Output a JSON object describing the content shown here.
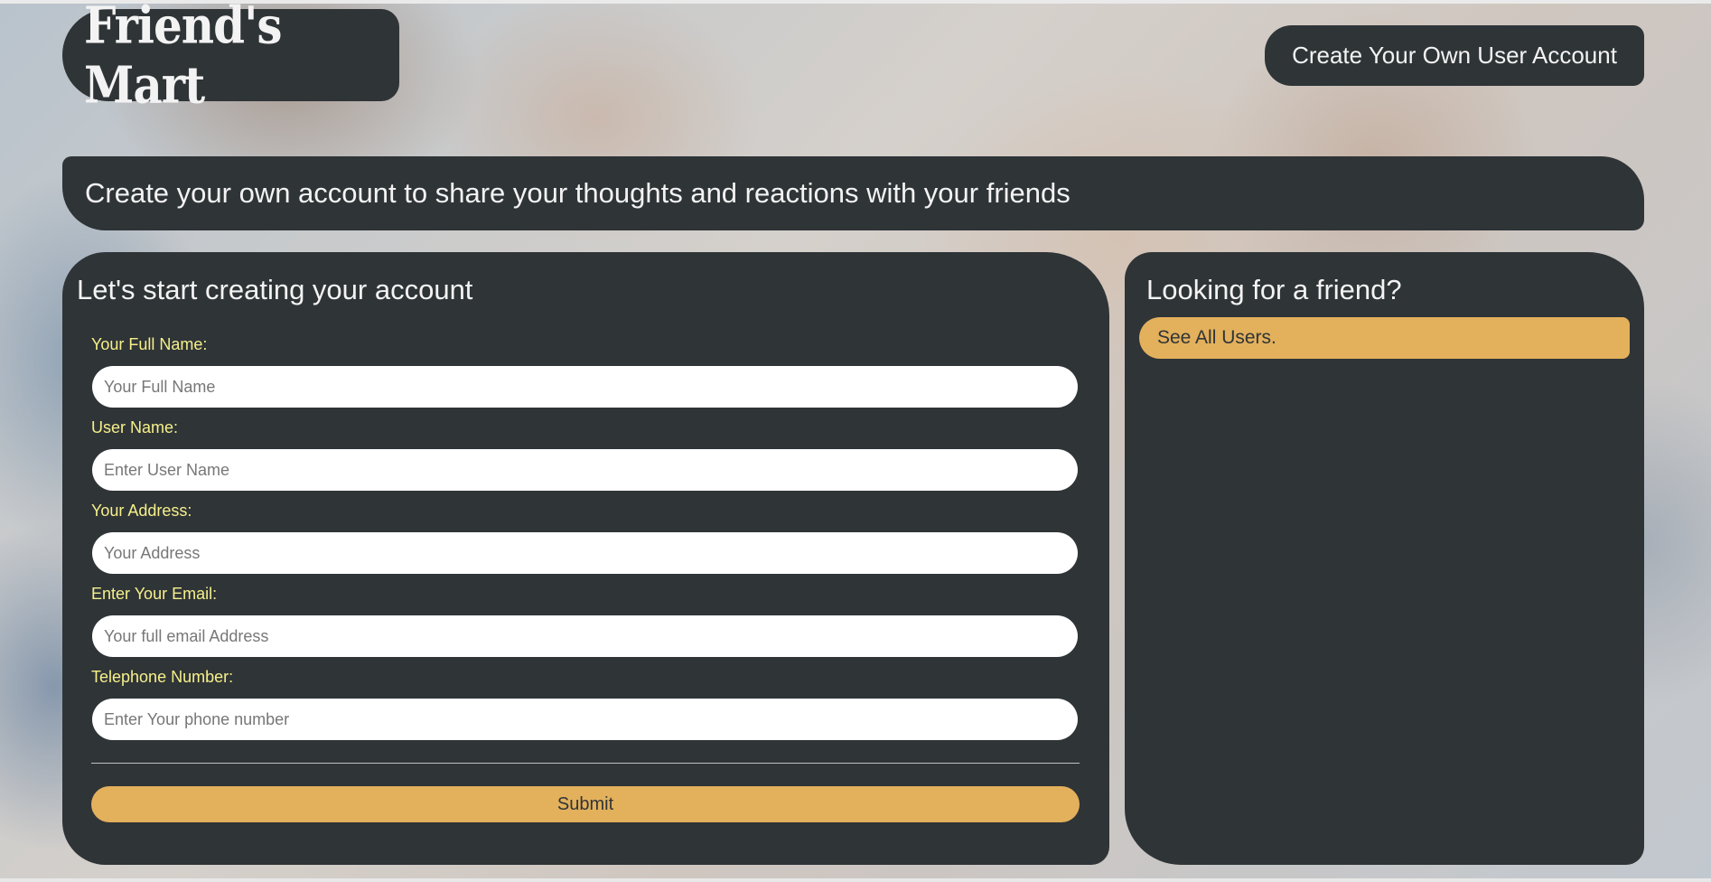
{
  "header": {
    "logo_text": "Friend's Mart",
    "nav_button_label": "Create Your Own User Account"
  },
  "banner": {
    "text": "Create your own account to share your thoughts and reactions with your friends"
  },
  "form": {
    "title": "Let's start creating your account",
    "fields": [
      {
        "label": "Your Full Name:",
        "placeholder": "Your Full Name"
      },
      {
        "label": "User Name:",
        "placeholder": "Enter User Name"
      },
      {
        "label": "Your Address:",
        "placeholder": "Your Address"
      },
      {
        "label": "Enter Your Email:",
        "placeholder": "Your full email Address"
      },
      {
        "label": "Telephone Number:",
        "placeholder": "Enter Your phone number"
      }
    ],
    "submit_label": "Submit"
  },
  "sidebar": {
    "title": "Looking for a friend?",
    "link_label": "See All Users."
  },
  "colors": {
    "panel": "#2f3437",
    "accent": "#e3b05c",
    "label": "#f6f08a",
    "text_light": "#f3f3f3"
  }
}
